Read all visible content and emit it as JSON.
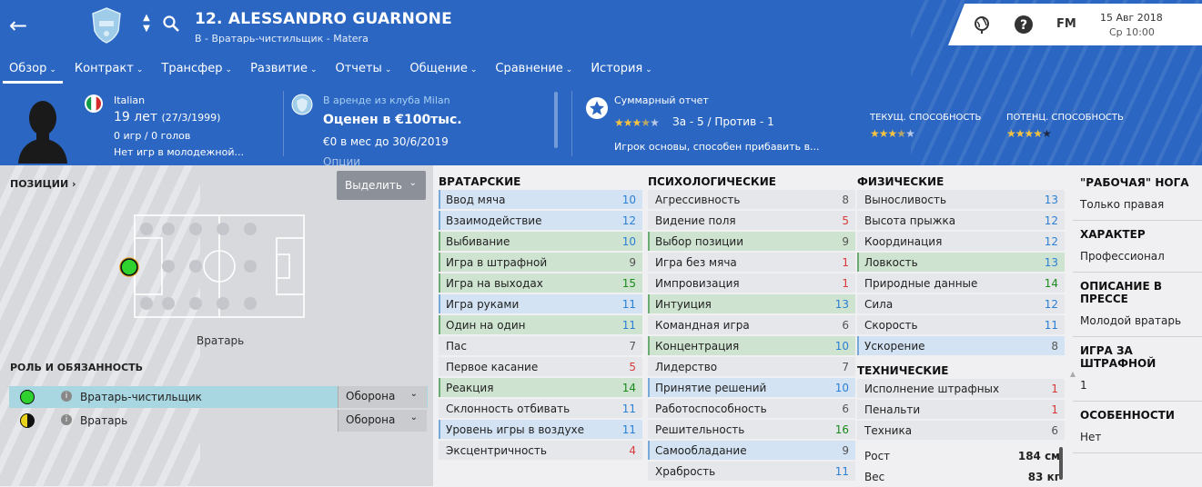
{
  "header": {
    "player_name": "12. ALESSANDRO GUARNONE",
    "subtitle": "В - Вратарь-чистильщик - Matera",
    "date": "15 Авг 2018",
    "time": "Ср 10:00",
    "fm_label": "FM"
  },
  "tabs": [
    "Обзор",
    "Контракт",
    "Трансфер",
    "Развитие",
    "Отчеты",
    "Общение",
    "Сравнение",
    "История"
  ],
  "overview": {
    "nationality": "Italian",
    "age": "19 лет",
    "birth": "(27/3/1999)",
    "games": "0 игр / 0 голов",
    "youth": "Нет игр в молодежной...",
    "loan": "В аренде из клуба Milan",
    "value": "Оценен в €100тыс.",
    "wage": "€0 в мес до 30/6/2019",
    "cut": "Опции",
    "report_title": "Суммарный отчет",
    "report_pros_cons": "За - 5 / Против - 1",
    "report_text": "Игрок основы, способен прибавить в...",
    "cur_ability_label": "ТЕКУЩ. СПОСОБНОСТЬ",
    "pot_ability_label": "ПОТЕНЦ. СПОСОБНОСТЬ",
    "report_stars": 3.5,
    "cur_stars": 3.5,
    "pot_stars": 5
  },
  "positions": {
    "title": "ПОЗИЦИИ",
    "select_label": "Выделить",
    "pos_caption": "Вратарь",
    "role_title": "РОЛЬ И ОБЯЗАННОСТЬ",
    "roles": [
      {
        "name": "Вратарь-чистильщик",
        "duty": "Оборона",
        "color": "#2fd12f"
      },
      {
        "name": "Вратарь",
        "duty": "Оборона",
        "color": "#e8d21a"
      }
    ]
  },
  "colors": {
    "high": "#1a8a1a",
    "mid": "#2b7fd4",
    "low": "#555555",
    "bad": "#d63a3a",
    "green_bg": "#cfe3d1",
    "blue_bg": "#d3e3f3"
  },
  "attributes": {
    "gk": {
      "title": "ВРАТАРСКИЕ",
      "items": [
        {
          "name": "Ввод мяча",
          "value": 10,
          "hl": "blue"
        },
        {
          "name": "Взаимодействие",
          "value": 12,
          "hl": "blue"
        },
        {
          "name": "Выбивание",
          "value": 10,
          "hl": "green"
        },
        {
          "name": "Игра в штрафной",
          "value": 9,
          "hl": "green"
        },
        {
          "name": "Игра на выходах",
          "value": 15,
          "hl": "green"
        },
        {
          "name": "Игра руками",
          "value": 11,
          "hl": "blue"
        },
        {
          "name": "Один на один",
          "value": 11,
          "hl": "green"
        },
        {
          "name": "Пас",
          "value": 7,
          "hl": ""
        },
        {
          "name": "Первое касание",
          "value": 5,
          "hl": ""
        },
        {
          "name": "Реакция",
          "value": 14,
          "hl": "green"
        },
        {
          "name": "Склонность отбивать",
          "value": 11,
          "hl": ""
        },
        {
          "name": "Уровень игры в воздухе",
          "value": 11,
          "hl": "blue"
        },
        {
          "name": "Эксцентричность",
          "value": 4,
          "hl": ""
        }
      ]
    },
    "mental": {
      "title": "ПСИХОЛОГИЧЕСКИЕ",
      "items": [
        {
          "name": "Агрессивность",
          "value": 8,
          "hl": ""
        },
        {
          "name": "Видение поля",
          "value": 5,
          "hl": ""
        },
        {
          "name": "Выбор позиции",
          "value": 9,
          "hl": "green"
        },
        {
          "name": "Игра без мяча",
          "value": 1,
          "hl": ""
        },
        {
          "name": "Импровизация",
          "value": 1,
          "hl": ""
        },
        {
          "name": "Интуиция",
          "value": 13,
          "hl": "green"
        },
        {
          "name": "Командная игра",
          "value": 6,
          "hl": ""
        },
        {
          "name": "Концентрация",
          "value": 10,
          "hl": "green"
        },
        {
          "name": "Лидерство",
          "value": 7,
          "hl": ""
        },
        {
          "name": "Принятие решений",
          "value": 10,
          "hl": "blue"
        },
        {
          "name": "Работоспособность",
          "value": 6,
          "hl": ""
        },
        {
          "name": "Решительность",
          "value": 16,
          "hl": ""
        },
        {
          "name": "Самообладание",
          "value": 9,
          "hl": "blue"
        },
        {
          "name": "Храбрость",
          "value": 11,
          "hl": ""
        }
      ]
    },
    "physical": {
      "title": "ФИЗИЧЕСКИЕ",
      "items": [
        {
          "name": "Выносливость",
          "value": 13,
          "hl": ""
        },
        {
          "name": "Высота прыжка",
          "value": 12,
          "hl": ""
        },
        {
          "name": "Координация",
          "value": 12,
          "hl": ""
        },
        {
          "name": "Ловкость",
          "value": 13,
          "hl": "green"
        },
        {
          "name": "Природные данные",
          "value": 14,
          "hl": ""
        },
        {
          "name": "Сила",
          "value": 12,
          "hl": ""
        },
        {
          "name": "Скорость",
          "value": 11,
          "hl": ""
        },
        {
          "name": "Ускорение",
          "value": 8,
          "hl": "blue"
        }
      ]
    },
    "technical": {
      "title": "ТЕХНИЧЕСКИЕ",
      "items": [
        {
          "name": "Исполнение штрафных",
          "value": 1,
          "hl": ""
        },
        {
          "name": "Пенальти",
          "value": 1,
          "hl": ""
        },
        {
          "name": "Техника",
          "value": 6,
          "hl": ""
        }
      ]
    },
    "body": [
      {
        "name": "Рост",
        "value": "184 см"
      },
      {
        "name": "Вес",
        "value": "83 кг"
      }
    ]
  },
  "side": [
    {
      "title": "\"РАБОЧАЯ\" НОГА",
      "text": "Только правая"
    },
    {
      "title": "ХАРАКТЕР",
      "text": "Профессионал"
    },
    {
      "title": "ОПИСАНИЕ В ПРЕССЕ",
      "text": "Молодой вратарь"
    },
    {
      "title": "ИГРА ЗА ШТРАФНОЙ",
      "text": "1"
    },
    {
      "title": "ОСОБЕННОСТИ",
      "text": "Нет"
    }
  ]
}
